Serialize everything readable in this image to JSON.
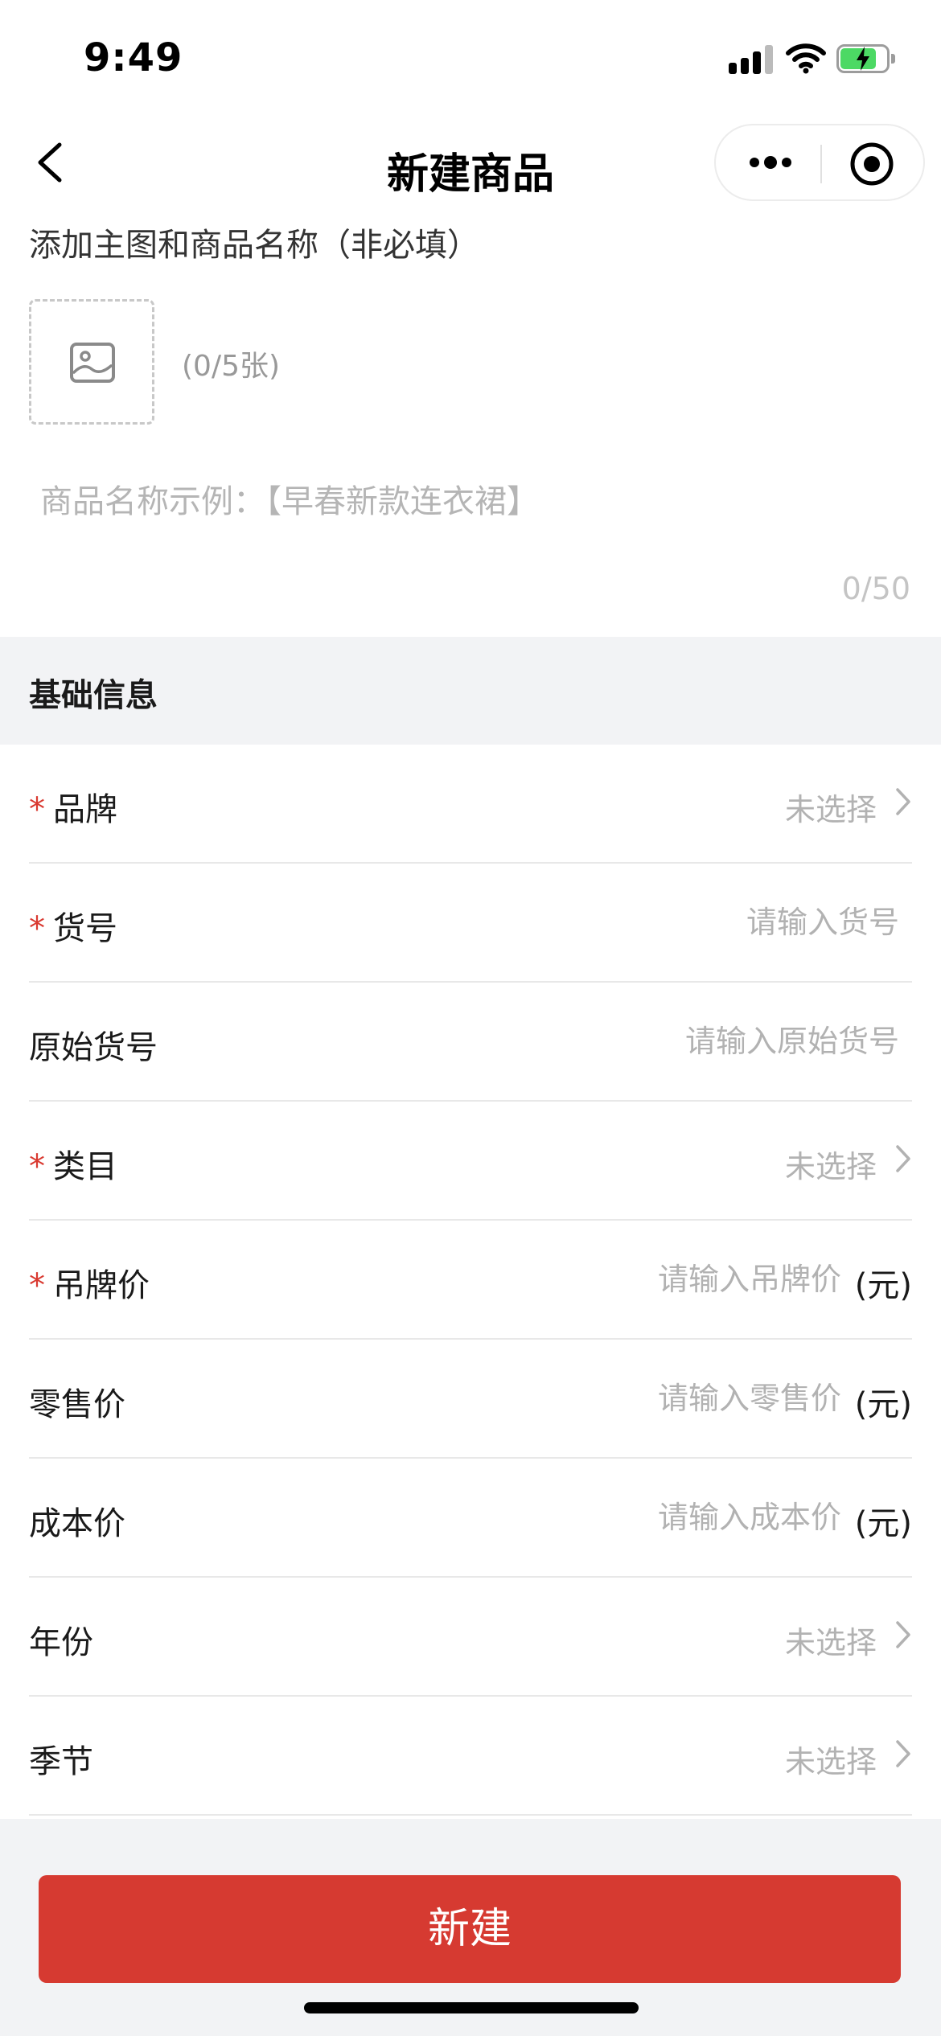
{
  "status_bar": {
    "time": "9:49"
  },
  "nav": {
    "title": "新建商品"
  },
  "media": {
    "hint": "添加主图和商品名称（非必填）",
    "upload_count": "(0/5张)",
    "name_placeholder": "商品名称示例：【早春新款连衣裙】",
    "name_counter": "0/50"
  },
  "section": {
    "title": "基础信息"
  },
  "form": {
    "brand": {
      "label": "品牌",
      "value": "未选择"
    },
    "item_no": {
      "label": "货号",
      "placeholder": "请输入货号"
    },
    "orig_item_no": {
      "label": "原始货号",
      "placeholder": "请输入原始货号"
    },
    "category": {
      "label": "类目",
      "value": "未选择"
    },
    "tag_price": {
      "label": "吊牌价",
      "placeholder": "请输入吊牌价",
      "unit": "(元)"
    },
    "retail_price": {
      "label": "零售价",
      "placeholder": "请输入零售价",
      "unit": "(元)"
    },
    "cost_price": {
      "label": "成本价",
      "placeholder": "请输入成本价",
      "unit": "(元)"
    },
    "year": {
      "label": "年份",
      "value": "未选择"
    },
    "season": {
      "label": "季节",
      "value": "未选择"
    },
    "required_mark": "*"
  },
  "actions": {
    "submit_label": "新建"
  },
  "colors": {
    "accent": "#d63a31",
    "placeholder": "#b2b2b2",
    "section_bg": "#f2f3f5"
  }
}
